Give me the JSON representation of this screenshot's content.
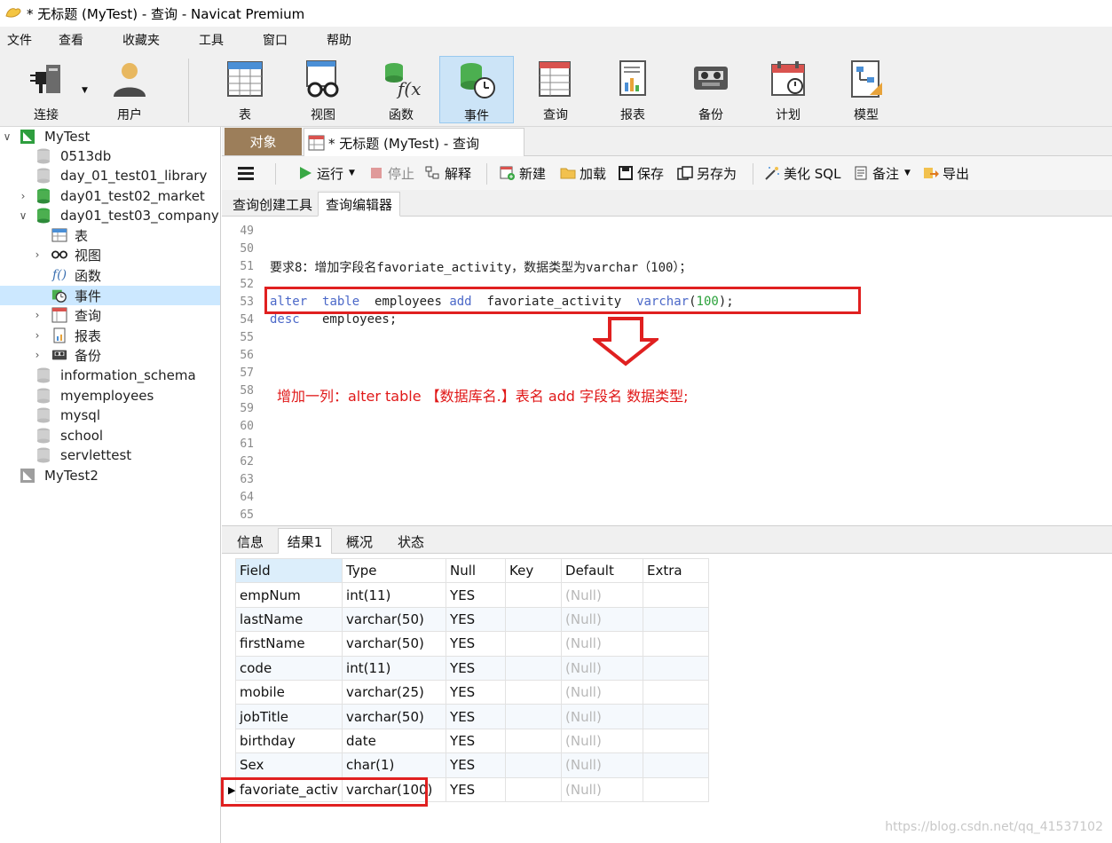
{
  "window": {
    "title": "* 无标题 (MyTest) - 查询 - Navicat Premium"
  },
  "menu": [
    "文件",
    "查看",
    "收藏夹",
    "工具",
    "窗口",
    "帮助"
  ],
  "toolbar": {
    "connect": "连接",
    "user": "用户",
    "table": "表",
    "view": "视图",
    "function": "函数",
    "event": "事件",
    "query": "查询",
    "report": "报表",
    "backup": "备份",
    "schedule": "计划",
    "model": "模型"
  },
  "sidebar": {
    "connection1": "MyTest",
    "db_0513": "0513db",
    "db_library": "day_01_test01_library",
    "db_market": "day01_test02_market",
    "db_company": "day01_test03_company",
    "node_table": "表",
    "node_view": "视图",
    "node_function": "函数",
    "node_event": "事件",
    "node_query": "查询",
    "node_report": "报表",
    "node_backup": "备份",
    "db_info": "information_schema",
    "db_myemployees": "myemployees",
    "db_mysql": "mysql",
    "db_school": "school",
    "db_servlettest": "servlettest",
    "connection2": "MyTest2"
  },
  "tabs": {
    "objects": "对象",
    "query_tab": "* 无标题 (MyTest) - 查询"
  },
  "query_toolbar": {
    "run": "运行",
    "stop": "停止",
    "explain": "解释",
    "new": "新建",
    "load": "加载",
    "save": "保存",
    "save_as": "另存为",
    "beautify": "美化 SQL",
    "comment": "备注",
    "export": "导出"
  },
  "sub_tabs": {
    "builder": "查询创建工具",
    "editor": "查询编辑器"
  },
  "editor": {
    "line_numbers": [
      "49",
      "50",
      "51",
      "52",
      "53",
      "54",
      "55",
      "56",
      "57",
      "58",
      "59",
      "60",
      "61",
      "62",
      "63",
      "64",
      "65"
    ],
    "line51": "要求8：增加字段名favoriate_activity，数据类型为varchar（100）；",
    "line53": {
      "kw_alter": "alter",
      "kw_table": "table",
      "t1": "  employees ",
      "kw_add": "add",
      "t2": "  favoriate_activity  ",
      "kw_varchar": "varchar",
      "paren_open": "(",
      "num": "100",
      "paren_close": ");"
    },
    "line54": {
      "kw_desc": "desc",
      "t1": "   employees;"
    },
    "annotation": "增加一列：alter   table   【数据库名.】表名   add  字段名  数据类型;"
  },
  "result_tabs": {
    "info": "信息",
    "result1": "结果1",
    "profile": "概况",
    "status": "状态"
  },
  "result": {
    "columns": [
      "Field",
      "Type",
      "Null",
      "Key",
      "Default",
      "Extra"
    ],
    "rows": [
      [
        "empNum",
        "int(11)",
        "YES",
        "",
        "(Null)",
        ""
      ],
      [
        "lastName",
        "varchar(50)",
        "YES",
        "",
        "(Null)",
        ""
      ],
      [
        "firstName",
        "varchar(50)",
        "YES",
        "",
        "(Null)",
        ""
      ],
      [
        "code",
        "int(11)",
        "YES",
        "",
        "(Null)",
        ""
      ],
      [
        "mobile",
        "varchar(25)",
        "YES",
        "",
        "(Null)",
        ""
      ],
      [
        "jobTitle",
        "varchar(50)",
        "YES",
        "",
        "(Null)",
        ""
      ],
      [
        "birthday",
        "date",
        "YES",
        "",
        "(Null)",
        ""
      ],
      [
        "Sex",
        "char(1)",
        "YES",
        "",
        "(Null)",
        ""
      ],
      [
        "favoriate_activ",
        "varchar(100)",
        "YES",
        "",
        "(Null)",
        ""
      ]
    ]
  },
  "watermark": "https://blog.csdn.net/qq_41537102",
  "colors": {
    "annotation": "#e02020",
    "keyword": "#4b68c8",
    "number": "#2aa13a",
    "selected": "#cce8ff"
  }
}
